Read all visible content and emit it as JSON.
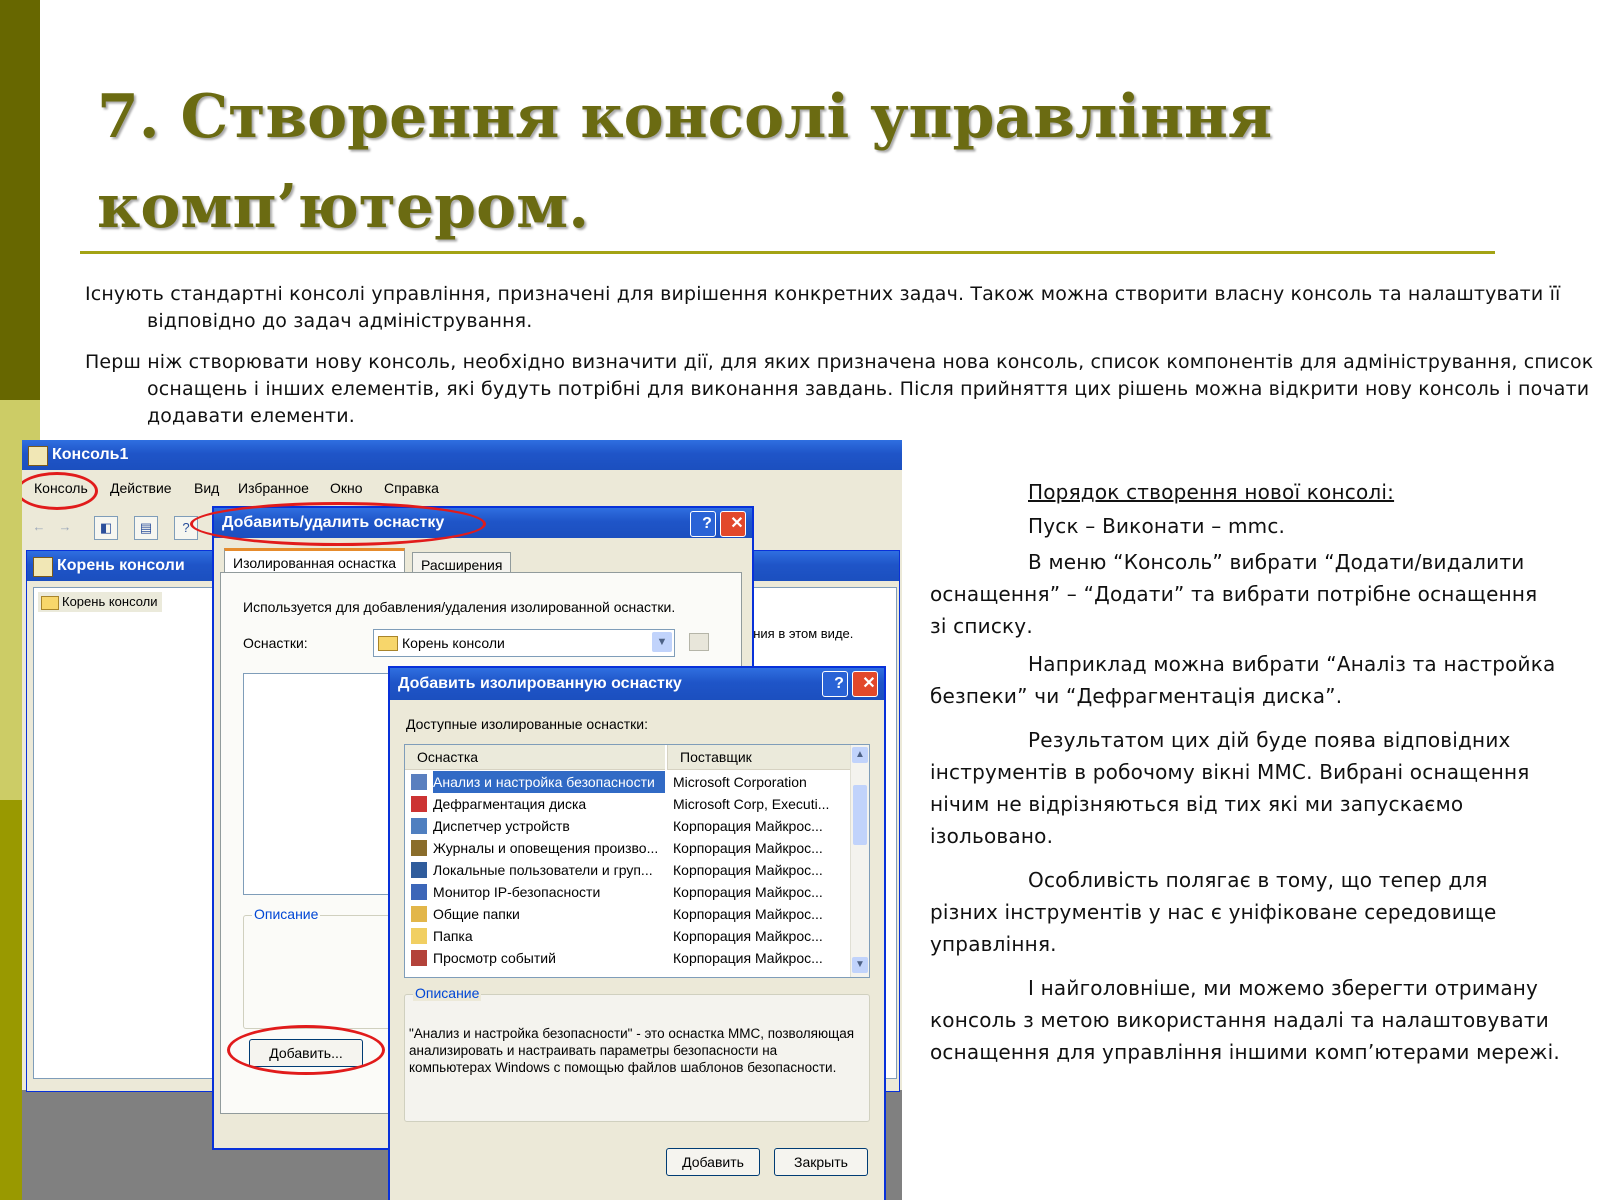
{
  "slide": {
    "title_line1": "7. Створення консолі управління",
    "title_line2": "комп’ютером.",
    "paragraph1": "Існують стандартні консолі управління, призначені для вирішення конкретних задач. Також можна створити власну консоль та налаштувати її відповідно до задач адміністрування.",
    "paragraph2": "Перш ніж створювати нову консоль, необхідно визначити дії, для яких призначена нова консоль, список компонентів для адміністрування, список оснащень і інших елементів, які будуть потрібні для виконання завдань. Після прийняття цих рішень можна відкрити нову консоль і почати додавати елементи."
  },
  "right_column": {
    "heading": "Порядок створення нової консолі:",
    "step1": "Пуск – Виконати – mmc.",
    "step2": "В меню “Консоль” вибрати “Додати/видалити оснащення” – “Додати” та вибрати потрібне оснащення зі списку.",
    "step3": "Наприклад можна вибрати “Аналіз та настройка безпеки” чи “Дефрагментація диска”.",
    "step4": "Результатом цих дій буде поява відповідних інструментів в робочому вікні MMC. Вибрані оснащення нічим не відрізняються від тих які ми запускаємо ізольовано.",
    "step5": "Особливість полягає в тому, що тепер для різних інструментів у нас є уніфіковане середовище управління.",
    "step6": "І найголовніше, ми можемо зберегти отриману консоль з метою використання надалі та налаштовувати оснащення для управління іншими комп’ютерами мережі."
  },
  "screenshot": {
    "main_window": {
      "title": "Консоль1",
      "menu": [
        "Консоль",
        "Действие",
        "Вид",
        "Избранное",
        "Окно",
        "Справка"
      ]
    },
    "child_window": {
      "title": "Корень консоли",
      "tree_item": "Корень консоли",
      "right_text": "ения в этом виде."
    },
    "dialog_add_remove": {
      "title": "Добавить/удалить оснастку",
      "help": "?",
      "close": "✕",
      "tabs": [
        "Изолированная оснастка",
        "Расширения"
      ],
      "description_text": "Используется для добавления/удаления изолированной оснастки.",
      "snapins_label": "Оснастки:",
      "snapins_value": "Корень консоли",
      "group_label": "Описание",
      "add_button": "Добавить..."
    },
    "dialog_add_standalone": {
      "title": "Добавить изолированную оснастку",
      "help": "?",
      "close": "✕",
      "available_label": "Доступные изолированные оснастки:",
      "columns": [
        "Оснастка",
        "Поставщик"
      ],
      "rows": [
        {
          "name": "Анализ и настройка безопасности",
          "vendor": "Microsoft Corporation",
          "icon": "security-analysis-icon",
          "selected": true
        },
        {
          "name": "Дефрагментация диска",
          "vendor": "Microsoft Corp, Executi...",
          "icon": "defrag-icon",
          "selected": false
        },
        {
          "name": "Диспетчер устройств",
          "vendor": "Корпорация Майкрос...",
          "icon": "device-manager-icon",
          "selected": false
        },
        {
          "name": "Журналы и оповещения произво...",
          "vendor": "Корпорация Майкрос...",
          "icon": "performance-logs-icon",
          "selected": false
        },
        {
          "name": "Локальные пользователи и груп...",
          "vendor": "Корпорация Майкрос...",
          "icon": "local-users-icon",
          "selected": false
        },
        {
          "name": "Монитор IP-безопасности",
          "vendor": "Корпорация Майкрос...",
          "icon": "ip-security-icon",
          "selected": false
        },
        {
          "name": "Общие папки",
          "vendor": "Корпорация Майкрос...",
          "icon": "shared-folders-icon",
          "selected": false
        },
        {
          "name": "Папка",
          "vendor": "Корпорация Майкрос...",
          "icon": "folder-icon",
          "selected": false
        },
        {
          "name": "Просмотр событий",
          "vendor": "Корпорация Майкрос...",
          "icon": "event-viewer-icon",
          "selected": false
        }
      ],
      "group_label": "Описание",
      "description": "\"Анализ и настройка безопасности\" - это оснастка MMC, позволяющая анализировать и настраивать параметры безопасности на компьютерах Windows с помощью файлов шаблонов безопасности.",
      "add_button": "Добавить",
      "close_button": "Закрыть"
    }
  },
  "colors": {
    "title": "#6b6b12",
    "accent_bar": "#676700",
    "highlight_oval": "#e11b1b",
    "xp_title": "#1f55c8"
  }
}
